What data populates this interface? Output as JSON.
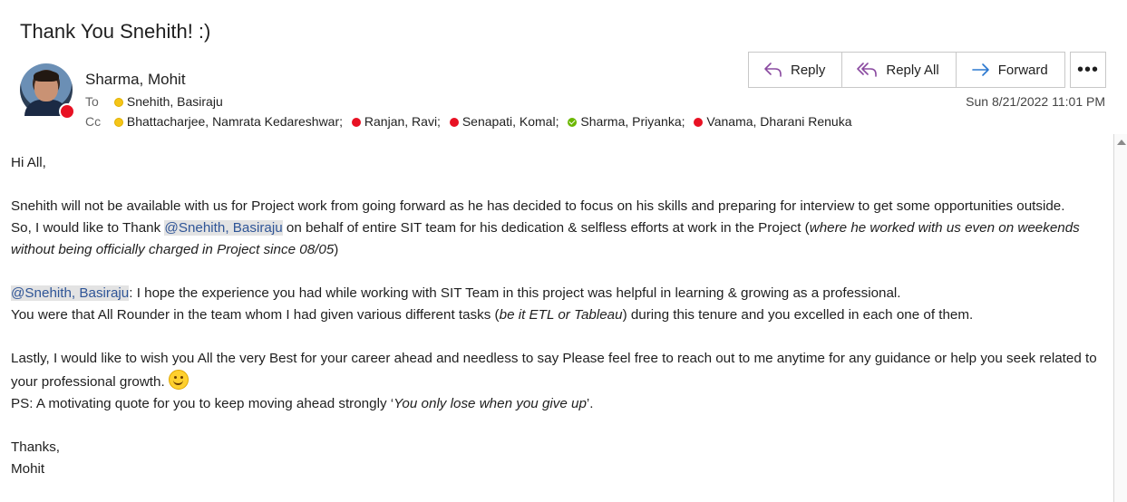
{
  "email": {
    "subject": "Thank You Snehith! :)",
    "sender": "Sharma, Mohit",
    "to_label": "To",
    "cc_label": "Cc",
    "to": [
      {
        "name": "Snehith, Basiraju",
        "status": "away"
      }
    ],
    "cc": [
      {
        "name": "Bhattacharjee, Namrata Kedareshwar;",
        "status": "away"
      },
      {
        "name": "Ranjan, Ravi;",
        "status": "busy"
      },
      {
        "name": "Senapati, Komal;",
        "status": "busy"
      },
      {
        "name": "Sharma, Priyanka;",
        "status": "available"
      },
      {
        "name": "Vanama, Dharani Renuka",
        "status": "busy"
      }
    ],
    "date": "Sun 8/21/2022 11:01 PM"
  },
  "actions": {
    "reply": "Reply",
    "reply_all": "Reply All",
    "forward": "Forward",
    "more": "•••"
  },
  "body": {
    "greeting": "Hi All,",
    "p1": "Snehith will not be available with us for Project work from going forward as he has decided to focus on his skills and preparing for interview to get some opportunities outside.",
    "p2_before": "So, I would like to Thank ",
    "mention": "@Snehith, Basiraju",
    "p2_middle": " on behalf of entire SIT team for his dedication & selfless efforts at work in the Project (",
    "p2_italic": "where he worked with us even on weekends without being officially charged in Project since 08/05",
    "p2_end": ")",
    "p3_after": ": I hope the experience you had while working with SIT Team in this project was helpful in learning & growing as a professional.",
    "p4_before": "You were that All Rounder in the team whom I had given various different tasks (",
    "p4_italic": "be it ETL or Tableau",
    "p4_after": ") during this tenure and you excelled in each one of them.",
    "p5": "Lastly, I would like to wish you All the very Best for your career ahead and needless to say Please feel free to reach out to me anytime for any guidance or help you seek related to your professional growth.",
    "p6_before": "PS: A motivating quote for you to keep moving ahead strongly ‘",
    "p6_italic": "You only lose when you give up",
    "p6_after": "’.",
    "closing": "Thanks,",
    "signature": "Mohit"
  },
  "colors": {
    "mention_text": "#2f5597",
    "mention_bg": "#e3e3e3",
    "busy": "#e81123",
    "away": "#f5c518",
    "available": "#6bb700",
    "reply_icon": "#8a4aa0",
    "forward_icon": "#2b78d0"
  }
}
